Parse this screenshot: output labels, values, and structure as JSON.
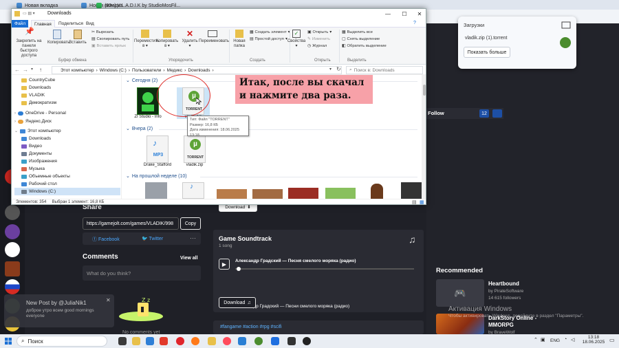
{
  "browser": {
    "tabs": [
      {
        "label": "Новая вкладка",
        "color": "#4a90d9"
      },
      {
        "label": "Новая вкладка",
        "color": "#4a90d9"
      },
      {
        "label": "(99+) V.L.A.D.I.K by StudioMosFil...",
        "color": "#2fbd5a"
      }
    ]
  },
  "download_popup": {
    "title": "Загрузки",
    "filename": "vladik.zip (1).torrent",
    "show_more": "Показать больше"
  },
  "site": {
    "follow": {
      "label": "Follow",
      "count": "12"
    },
    "download_top": "Download",
    "share": {
      "title": "Share",
      "url": "https://gamejolt.com/games/VLADIK/998",
      "copy": "Copy",
      "facebook": "Facebook",
      "twitter": "Twitter"
    },
    "comments": {
      "title": "Comments",
      "view_all": "View all",
      "placeholder": "What do you think?",
      "empty": "No comments yet"
    },
    "soundtrack": {
      "title": "Game Soundtrack",
      "count": "1 song",
      "current_track": "Александр Градский — Песня смелого моряка (радио)",
      "list_item": "1. Александр Градский — Песни смелого моряка (радио)",
      "download": "Download"
    },
    "tags": "#fangame #action #rpg #scifi",
    "notification": {
      "title": "New Post by @JuliaNik1",
      "body": "доброе утро всем good mornings everyone"
    },
    "recommended": {
      "title": "Recommended",
      "items": [
        {
          "title": "Heartbound",
          "author": "by PirateSoftware",
          "followers": "14 615 followers",
          "author_label": "",
          "followers_label": ""
        },
        {
          "title": "DarkStory Online - MMORPG",
          "author": "by BraveWolf",
          "followers": ""
        }
      ]
    },
    "activation": {
      "title": "Активация Windows",
      "body": "Чтобы активировать Windows, перейдите в раздел \"Параметры\"."
    }
  },
  "explorer": {
    "title": "Downloads",
    "menu": [
      "Файл",
      "Главная",
      "Поделиться",
      "Вид"
    ],
    "ribbon": {
      "pin": "Закрепить на панели быстрого доступа",
      "copy": "Копировать",
      "paste": "Вставить",
      "cut": "Вырезать",
      "copy_path": "Скопировать путь",
      "paste_shortcut": "Вставить ярлык",
      "move_to": "Переместить в",
      "copy_to": "Копировать в",
      "delete": "Удалить",
      "rename": "Переименовать",
      "new_folder": "Новая папка",
      "new_item": "Создать элемент",
      "easy_access": "Простой доступ",
      "properties": "Свойства",
      "open": "Открыть",
      "edit": "Изменить",
      "history": "Журнал",
      "select_all": "Выделить все",
      "select_none": "Снять выделение",
      "invert": "Обратить выделение",
      "groups": [
        "Буфер обмена",
        "Упорядочить",
        "Создать",
        "Открыть",
        "Выделить"
      ]
    },
    "address": [
      "Этот компьютер",
      "Windows (C:)",
      "Пользователи",
      "Медикс",
      "Downloads"
    ],
    "search_placeholder": "Поиск в: Downloads",
    "nav": [
      {
        "label": "CountryCube",
        "color": "#e8c04a"
      },
      {
        "label": "Downloads",
        "color": "#e8c04a"
      },
      {
        "label": "VLADIK",
        "color": "#e8c04a"
      },
      {
        "label": "Демократизм",
        "color": "#e8c04a"
      },
      {
        "label": "OneDrive - Personal",
        "color": "#2b7cd3"
      },
      {
        "label": "Яндекс.Диск",
        "color": "#e9a23b"
      },
      {
        "label": "Этот компьютер",
        "color": "#3f87d6"
      },
      {
        "label": "Downloads",
        "color": "#3f87d6"
      },
      {
        "label": "Видео",
        "color": "#7d5bc4"
      },
      {
        "label": "Документы",
        "color": "#6e7d92"
      },
      {
        "label": "Изображения",
        "color": "#3aa0c9"
      },
      {
        "label": "Музыка",
        "color": "#d7664c"
      },
      {
        "label": "Объемные объекты",
        "color": "#3aa0c9"
      },
      {
        "label": "Рабочий стол",
        "color": "#3f87d6"
      },
      {
        "label": "Windows (C:)",
        "color": "#6f7c8a"
      }
    ],
    "groups": {
      "today": "Сегодня (2)",
      "yesterday": "Вчера (2)",
      "last_week": "На прошлой неделе (10)"
    },
    "files_today": [
      {
        "name": "ZI Studio - Info"
      },
      {
        "name": "vladik.zip"
      }
    ],
    "files_yesterday": [
      {
        "name": "Drake_Stafford"
      },
      {
        "name": "vladik.zip"
      }
    ],
    "torrent_label": "TORRENT",
    "mp3_label": "MP3",
    "tooltip": [
      "Тип: Файл \"TORRENT\"",
      "Размер: 16,8 КБ",
      "Дата изменения: 18.06.2025 13:18"
    ],
    "status": "Элементов: 354     Выбран 1 элемент: 16,8 КБ"
  },
  "instruction": "Итак, после вы скачал и нажмите два раза.",
  "taskbar": {
    "search": "Поиск",
    "lang": "ENG",
    "time": "13:18",
    "date": "18.06.2025"
  }
}
